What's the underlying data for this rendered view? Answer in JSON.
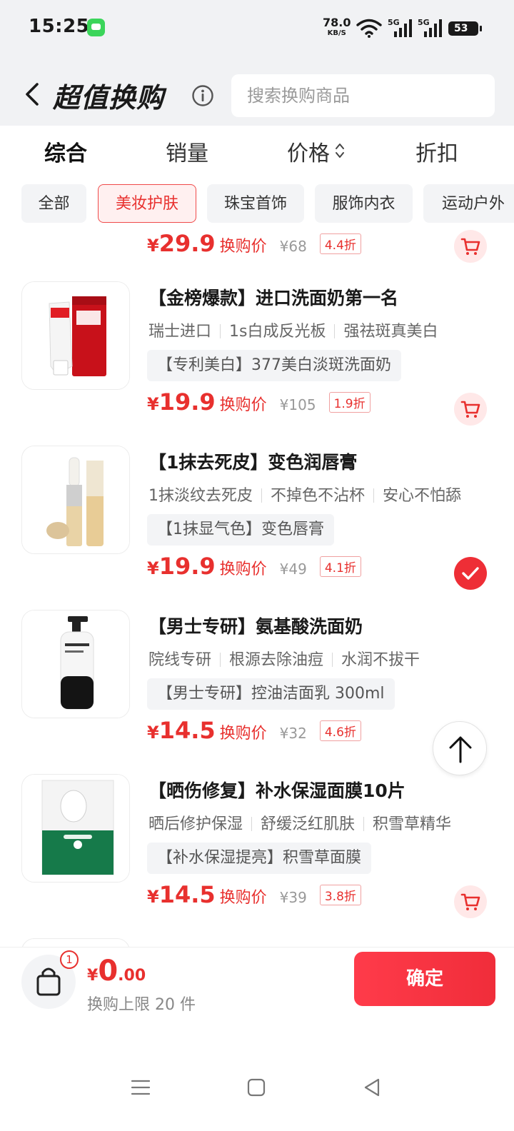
{
  "status_bar": {
    "time": "15:25",
    "net_speed_value": "78.0",
    "net_speed_unit": "KB/S",
    "signal_1": "5G",
    "signal_2": "5G",
    "battery": "53"
  },
  "header": {
    "title": "超值换购",
    "search_placeholder": "搜索换购商品"
  },
  "sort_tabs": [
    {
      "label": "综合",
      "active": true
    },
    {
      "label": "销量",
      "active": false
    },
    {
      "label": "价格",
      "active": false
    },
    {
      "label": "折扣",
      "active": false
    }
  ],
  "categories": [
    {
      "label": "全部",
      "active": false
    },
    {
      "label": "美妆护肤",
      "active": true
    },
    {
      "label": "珠宝首饰",
      "active": false
    },
    {
      "label": "服饰内衣",
      "active": false
    },
    {
      "label": "运动户外",
      "active": false
    }
  ],
  "partial_item": {
    "currency": "¥",
    "price": "29.9",
    "price_label": "换购价",
    "original_price": "¥68",
    "discount": "4.4折"
  },
  "products": [
    {
      "title": "【金榜爆款】进口洗面奶第一名",
      "tags": [
        "瑞士进口",
        "1s白成反光板",
        "强祛斑真美白"
      ],
      "pill": "【专利美白】377美白淡斑洗面奶",
      "currency": "¥",
      "price": "19.9",
      "price_label": "换购价",
      "original_price": "¥105",
      "discount": "1.9折",
      "selected": false
    },
    {
      "title": "【1抹去死皮】变色润唇膏",
      "tags": [
        "1抹淡纹去死皮",
        "不掉色不沾杯",
        "安心不怕舔"
      ],
      "pill": "【1抹显气色】变色唇膏",
      "currency": "¥",
      "price": "19.9",
      "price_label": "换购价",
      "original_price": "¥49",
      "discount": "4.1折",
      "selected": true
    },
    {
      "title": "【男士专研】氨基酸洗面奶",
      "tags": [
        "院线专研",
        "根源去除油痘",
        "水润不拔干"
      ],
      "pill": "【男士专研】控油洁面乳 300ml",
      "currency": "¥",
      "price": "14.5",
      "price_label": "换购价",
      "original_price": "¥32",
      "discount": "4.6折",
      "selected": false
    },
    {
      "title": "【晒伤修复】补水保湿面膜10片",
      "tags": [
        "晒后修护保湿",
        "舒缓泛红肌肤",
        "积雪草精华"
      ],
      "pill": "【补水保湿提亮】积雪草面膜",
      "currency": "¥",
      "price": "14.5",
      "price_label": "换购价",
      "original_price": "¥39",
      "discount": "3.8折",
      "selected": false
    }
  ],
  "bottom_bar": {
    "badge_count": "1",
    "currency": "¥",
    "total_int": "0",
    "total_dec": ".00",
    "limit_text": "换购上限 20 件",
    "confirm_label": "确定"
  },
  "colors": {
    "accent": "#e8302e",
    "accent_bg": "#ffe8e8",
    "chip_bg": "#f3f4f6",
    "header_bg": "#f1f2f4"
  }
}
